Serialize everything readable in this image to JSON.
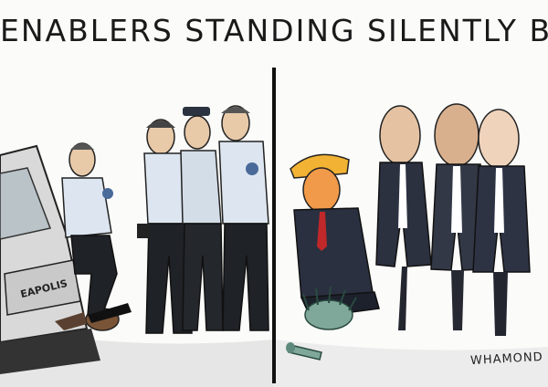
{
  "title": "ENABLERS STANDING SILENTLY BY",
  "car_text": "EAPOLIS",
  "signature": "WHAMOND"
}
